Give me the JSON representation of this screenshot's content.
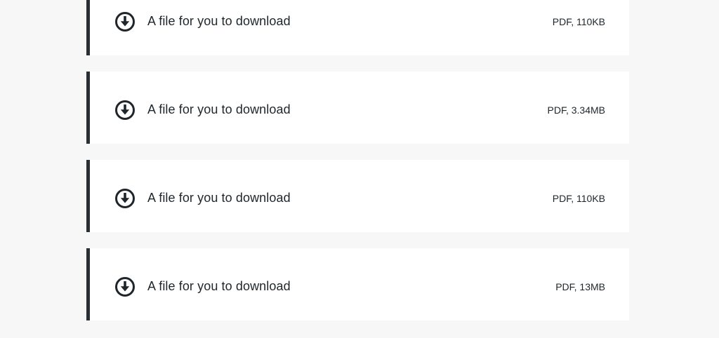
{
  "downloads": [
    {
      "title": "A file for you to download",
      "meta": "PDF, 110KB",
      "icon": "download-circle-icon"
    },
    {
      "title": "A file for you to download",
      "meta": "PDF, 3.34MB",
      "icon": "download-circle-icon"
    },
    {
      "title": "A file for you to download",
      "meta": "PDF, 110KB",
      "icon": "download-circle-icon"
    },
    {
      "title": "A file for you to download",
      "meta": "PDF, 13MB",
      "icon": "download-circle-icon"
    }
  ],
  "colors": {
    "background": "#f7f7f7",
    "card": "#ffffff",
    "accent_border": "#2a2f33",
    "text": "#1f262b",
    "icon": "#1f262b"
  }
}
